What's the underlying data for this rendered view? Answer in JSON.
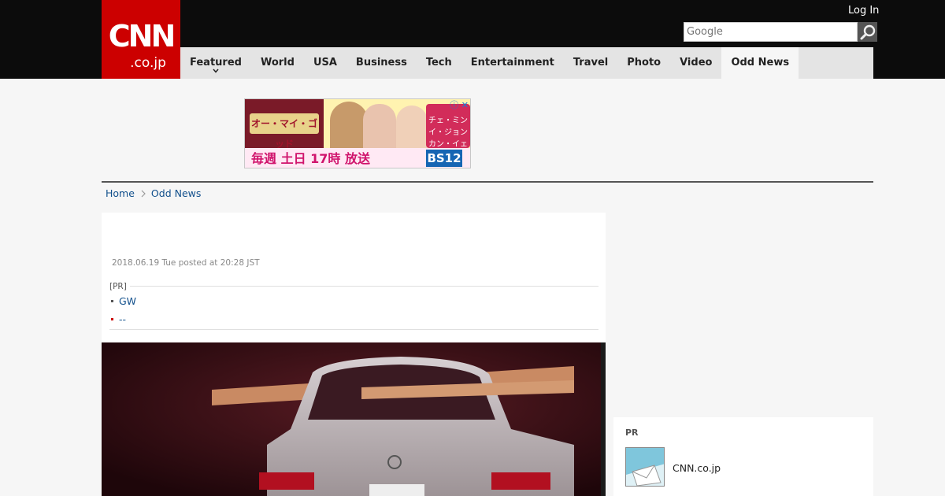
{
  "header": {
    "logo_main": "CNN",
    "logo_sub": ".co.jp",
    "login_label": "Log In",
    "search_placeholder": "Google",
    "search_icon": "magnifier-icon"
  },
  "nav": {
    "items": [
      {
        "label": "Featured",
        "has_dropdown": true
      },
      {
        "label": "World"
      },
      {
        "label": "USA"
      },
      {
        "label": "Business"
      },
      {
        "label": "Tech"
      },
      {
        "label": "Entertainment"
      },
      {
        "label": "Travel"
      },
      {
        "label": "Photo"
      },
      {
        "label": "Video"
      },
      {
        "label": "Odd News",
        "active": true
      }
    ]
  },
  "ad": {
    "title": "オー・マイ・ゴッド",
    "schedule": "毎週 土日 17時 放送",
    "channel": "BS12",
    "side_text": "チェ・ミン イ・ジョン カン・イェウォン 出演",
    "close_label": "ⓘ ✕"
  },
  "breadcrumb": {
    "home": "Home",
    "current": "Odd News"
  },
  "article": {
    "date": "2018.06.19 Tue posted at 20:28 JST",
    "pr_label": "[PR]",
    "pr_links": [
      "GW",
      "--"
    ]
  },
  "sidebar": {
    "pr_label": "PR",
    "pr_text": "CNN.co.jp"
  },
  "colors": {
    "brand_red": "#cc0000",
    "header_bg": "#0c0c0c",
    "link": "#12508c"
  }
}
